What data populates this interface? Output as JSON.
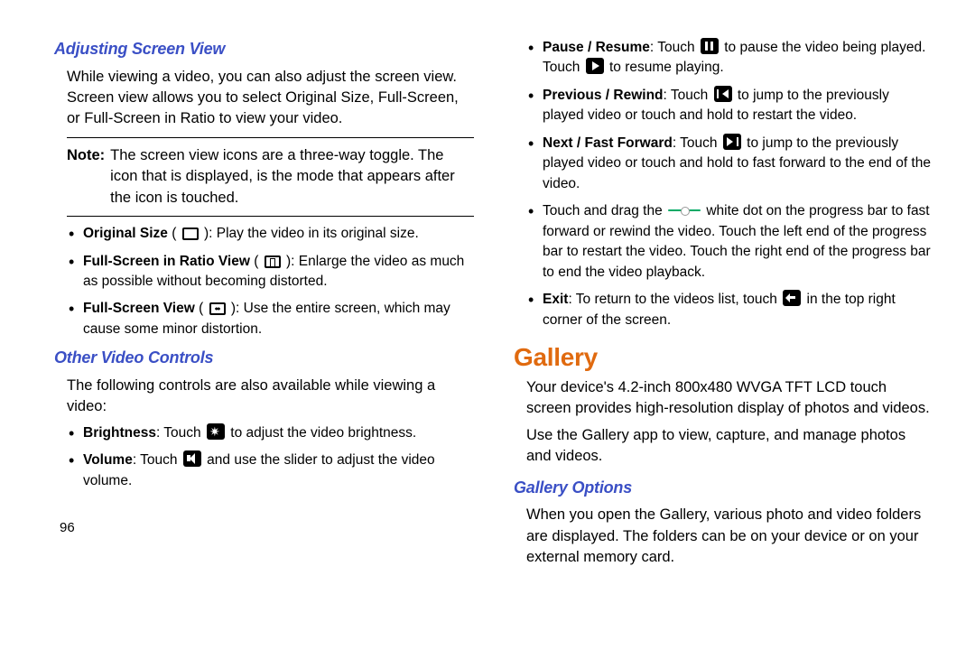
{
  "page_number": "96",
  "left": {
    "h1": "Adjusting Screen View",
    "p1": "While viewing a video, you can also adjust the screen view. Screen view allows you to select Original Size, Full-Screen, or Full-Screen in Ratio to view your video.",
    "note_label": "Note:",
    "note_body": "The screen view icons are a three-way toggle. The icon that is displayed, is the mode that appears after the icon is touched.",
    "b1": {
      "label": "Original Size",
      "paren_open": " ( ",
      "paren_close": " ): ",
      "rest": "Play the video in its original size."
    },
    "b2": {
      "label": "Full-Screen in Ratio View",
      "paren_open": " ( ",
      "paren_close": " ): ",
      "rest": "Enlarge the video as much as possible without becoming distorted."
    },
    "b3": {
      "label": "Full-Screen View",
      "paren_open": " ( ",
      "paren_close": " ): ",
      "rest": "Use the entire screen, which may cause some minor distortion."
    },
    "h2": "Other Video Controls",
    "p2": "The following controls are also available while viewing a video:",
    "b4": {
      "label": "Brightness",
      "mid": ": Touch ",
      "rest": " to adjust the video brightness."
    },
    "b5": {
      "label": "Volume",
      "mid": ": Touch ",
      "rest": " and use the slider to adjust the video volume."
    }
  },
  "right": {
    "b1": {
      "label": "Pause / Resume",
      "mid1": ": Touch ",
      "mid2": " to pause the video being played. Touch ",
      "rest": " to resume playing."
    },
    "b2": {
      "label": "Previous / Rewind",
      "mid": ": Touch ",
      "rest": " to jump to the previously played video or touch and hold to restart the video."
    },
    "b3": {
      "label": "Next / Fast Forward",
      "mid": ": Touch ",
      "rest": " to jump to the previously played video or touch and hold to fast forward to the end of the video."
    },
    "b4": {
      "pre": "Touch and drag the ",
      "rest": " white dot on the progress bar to fast forward or rewind the video. Touch the left end of the progress bar to restart the video. Touch the right end of the progress bar to end the video playback."
    },
    "b5": {
      "label": "Exit",
      "mid": ": To return to the videos list, touch ",
      "rest": " in the top right corner of the screen."
    },
    "h_gallery": "Gallery",
    "p_gallery1": "Your device's 4.2-inch 800x480 WVGA TFT LCD touch screen provides high-resolution display of photos and videos.",
    "p_gallery2": "Use the Gallery app to view, capture, and manage photos and videos.",
    "h_options": "Gallery Options",
    "p_options": "When you open the Gallery, various photo and video folders are displayed. The folders can be on your device or on your external memory card."
  }
}
